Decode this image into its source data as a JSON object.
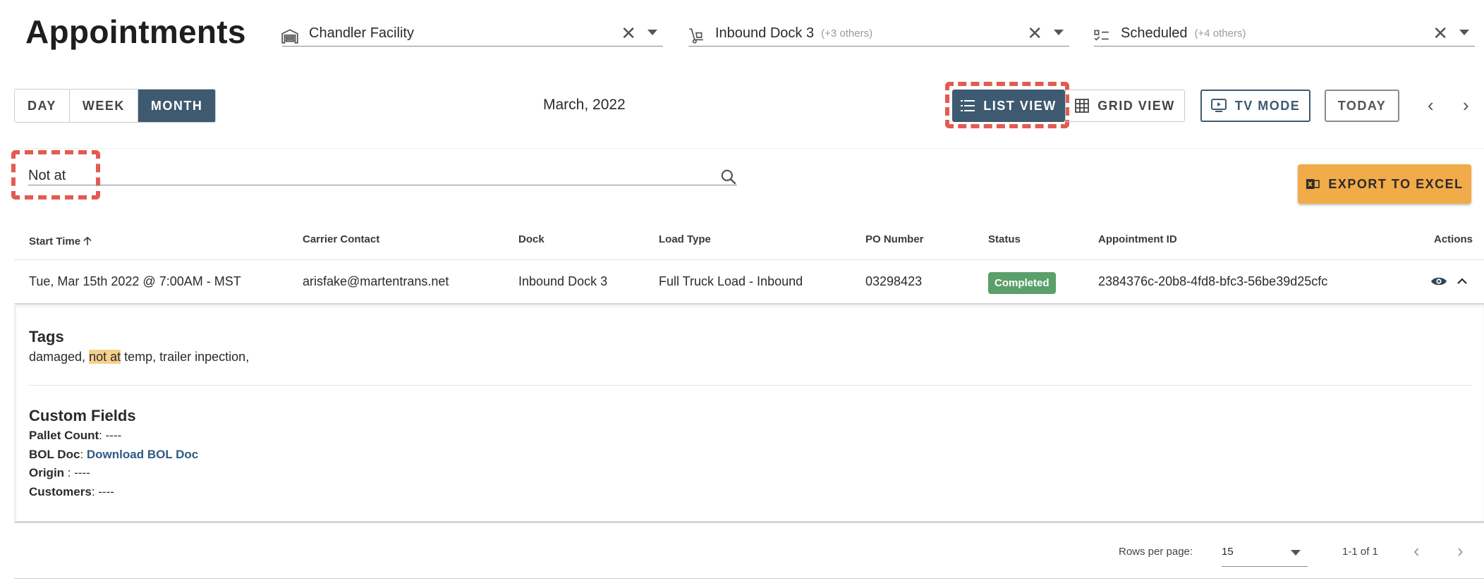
{
  "header": {
    "title": "Appointments",
    "filters": [
      {
        "value": "Chandler Facility",
        "extra": "",
        "icon": "warehouse-icon"
      },
      {
        "value": "Inbound Dock 3",
        "extra": "(+3 others)",
        "icon": "dolly-icon"
      },
      {
        "value": "Scheduled",
        "extra": "(+4 others)",
        "icon": "checklist-icon"
      }
    ]
  },
  "toolbar": {
    "views": [
      "DAY",
      "WEEK",
      "MONTH"
    ],
    "active_view": "MONTH",
    "period": "March, 2022",
    "list_view": "LIST VIEW",
    "grid_view": "GRID VIEW",
    "tv_mode": "TV MODE",
    "today": "TODAY"
  },
  "search": {
    "value": "Not at"
  },
  "export_label": "EXPORT TO EXCEL",
  "table": {
    "headers": {
      "start_time": "Start Time",
      "carrier_contact": "Carrier Contact",
      "dock": "Dock",
      "load_type": "Load Type",
      "po_number": "PO Number",
      "status": "Status",
      "appointment_id": "Appointment ID",
      "actions": "Actions"
    },
    "row": {
      "start_time": "Tue, Mar 15th 2022 @ 7:00AM - MST",
      "carrier_contact": "arisfake@martentrans.net",
      "dock": "Inbound Dock 3",
      "load_type": "Full Truck Load - Inbound",
      "po_number": "03298423",
      "status": "Completed",
      "appointment_id": "2384376c-20b8-4fd8-bfc3-56be39d25cfc"
    }
  },
  "details": {
    "tags_title": "Tags",
    "tags_before": "damaged, ",
    "tags_match": "not at",
    "tags_after": " temp, trailer inpection,",
    "custom_fields_title": "Custom Fields",
    "pallet_count_label": "Pallet Count",
    "pallet_count_value": "----",
    "bol_doc_label": "BOL Doc",
    "bol_doc_link": "Download BOL Doc",
    "origin_label": "Origin ",
    "origin_value": "----",
    "customers_label": "Customers",
    "customers_value": "----"
  },
  "pagination": {
    "rows_per_page_label": "Rows per page:",
    "rows_per_page": "15",
    "range": "1-1 of 1"
  },
  "colors": {
    "primary": "#3e5a70",
    "accent": "#f1ab48",
    "status_completed": "#5b9f6a",
    "highlight": "#e35b50"
  }
}
